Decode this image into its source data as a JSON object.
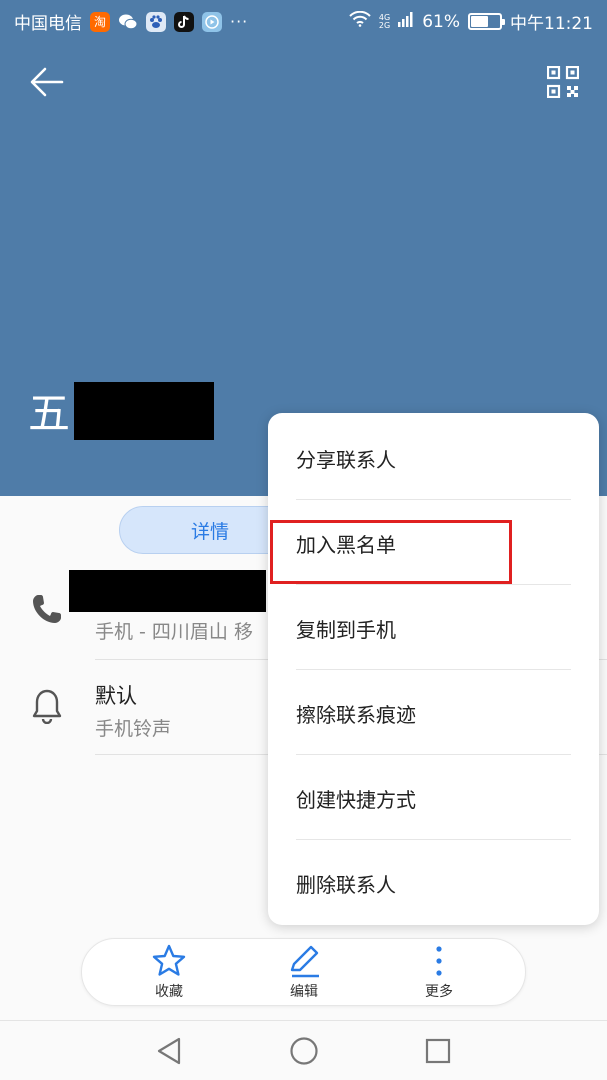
{
  "status_bar": {
    "carrier": "中国电信",
    "app_icons": [
      "taobao-icon",
      "wechat-icon",
      "baidu-icon",
      "tiktok-icon",
      "video-icon"
    ],
    "more": "···",
    "network": "4G",
    "network2": "2G",
    "battery_percent": "61%",
    "battery_level": 0.61,
    "time": "中午11:21"
  },
  "header": {
    "name_visible": "五",
    "background_color": "#4f7ca8"
  },
  "tabs": {
    "details_label": "详情"
  },
  "phone": {
    "subtitle": "手机 - 四川眉山 移"
  },
  "ringtone": {
    "title": "默认",
    "subtitle": "手机铃声"
  },
  "actions": [
    {
      "label": "收藏",
      "icon": "star-icon"
    },
    {
      "label": "编辑",
      "icon": "pencil-icon"
    },
    {
      "label": "更多",
      "icon": "more-vertical-icon"
    }
  ],
  "menu": {
    "items": [
      "分享联系人",
      "加入黑名单",
      "复制到手机",
      "擦除联系痕迹",
      "创建快捷方式",
      "删除联系人"
    ],
    "highlighted": "加入黑名单"
  },
  "colors": {
    "accent": "#2a7be4",
    "highlight": "#e02020"
  }
}
